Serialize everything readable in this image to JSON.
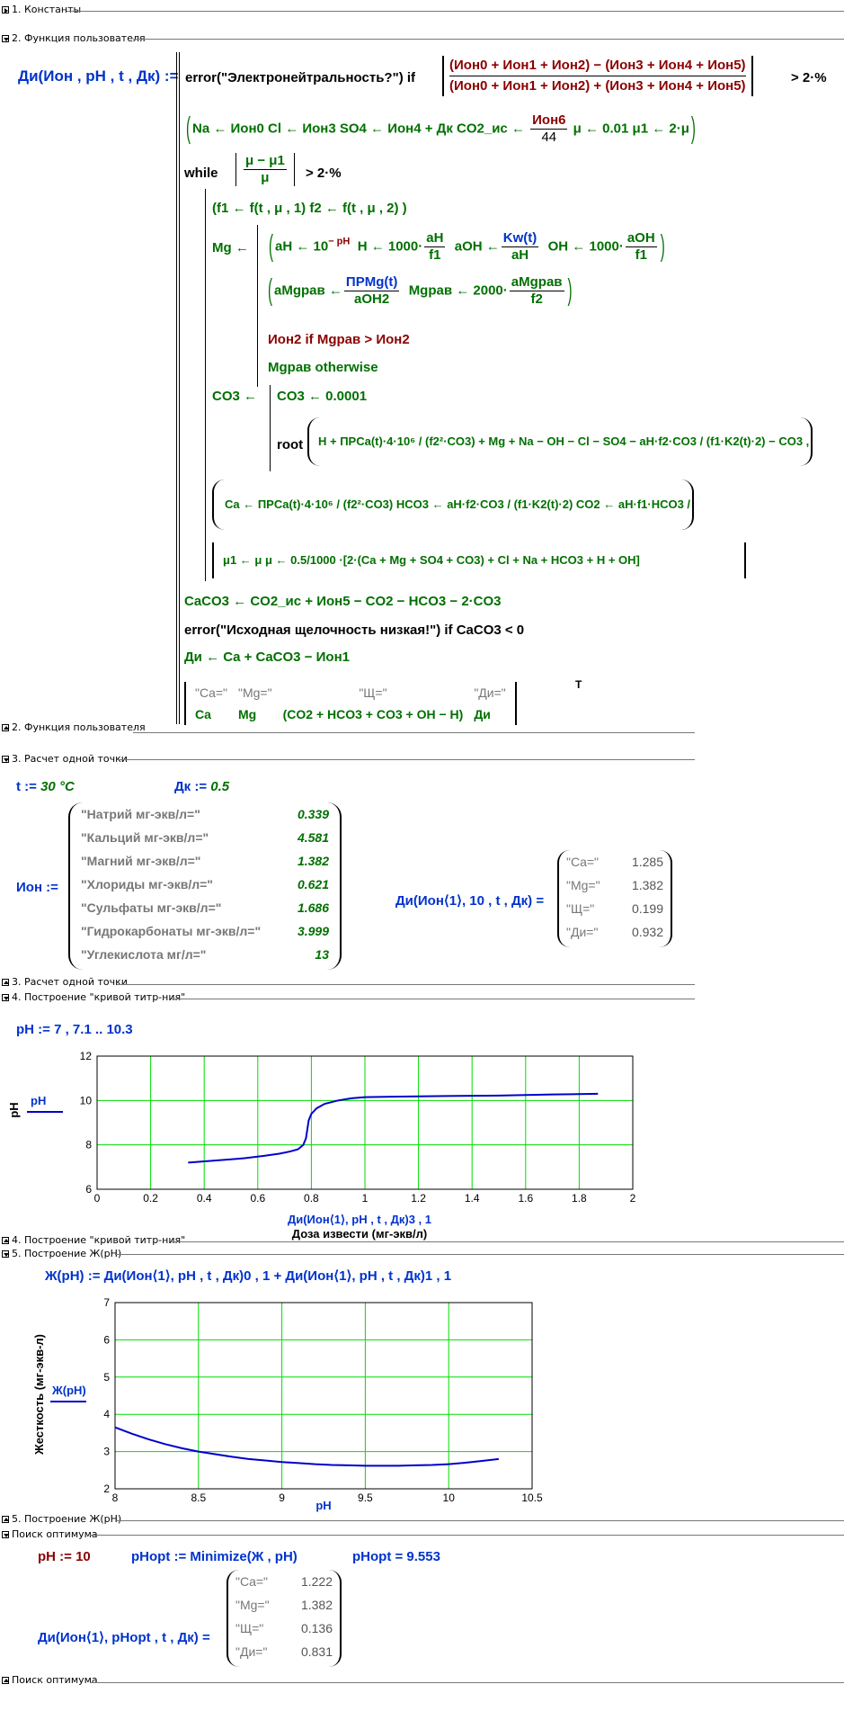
{
  "regions": {
    "r1": "1. Константы",
    "r2": "2. Функция пользователя",
    "r3": "3. Расчет одной точки",
    "r4": "4. Построение \"кривой титр-ния\"",
    "r5": "5. Построение Ж(pH)",
    "r6": "Поиск оптимума"
  },
  "func": {
    "header": "Ди(Ион , pH , t , Дк) :=",
    "error1": "error(\"Электронейтральность?\") if",
    "cond1_num": "(Ион0 + Ион1 + Ион2) − (Ион3 + Ион4 + Ион5)",
    "cond1_den": "(Ион0 + Ион1 + Ион2) + (Ион3 + Ион4 + Ион5)",
    "cond1_rhs": "> 2·%",
    "assign1": "Na ← Ион0   Cl ← Ион3   SO4 ← Ион4 + Дк   CO2_ис ←",
    "assign1_frac_n": "Ион6",
    "assign1_frac_d": "44",
    "assign1_tail": "μ ← 0.01   μ1 ← 2·μ",
    "while": "while",
    "while_num": "μ − μ1",
    "while_den": "μ",
    "while_rhs": "> 2·%",
    "f_line": "(f1 ← f(t , μ , 1)   f2 ← f(t , μ , 2) )",
    "mg": "Mg ←",
    "mg_l1a": "aH ← 10",
    "mg_l1a_sup": "− pH",
    "mg_l1b": "H ← 1000·",
    "mg_l1b_n": "aH",
    "mg_l1b_d": "f1",
    "mg_l1c": "aOH ←",
    "mg_l1c_n": "Kw(t)",
    "mg_l1c_d": "aH",
    "mg_l1d": "OH ← 1000·",
    "mg_l1d_n": "aOH",
    "mg_l1d_d": "f1",
    "mg_l2a": "aMgрав ←",
    "mg_l2a_n": "ПРMg(t)",
    "mg_l2a_d": "aOH2",
    "mg_l2b": "Mgрав ← 2000·",
    "mg_l2b_n": "aMgрав",
    "mg_l2b_d": "f2",
    "mg_l3": "Ион2   if   Mgрав > Ион2",
    "mg_l4": "Mgрав   otherwise",
    "co3": "CO3 ←",
    "co3_l1": "CO3 ← 0.0001",
    "co3_root": "root",
    "co3_root_expr": "H + ПРCa(t)·4·10⁶ / (f2²·CO3) + Mg + Na − OH − Cl − SO4 − aH·f2·CO3 / (f1·K2(t)·2) − CO3 , CO3",
    "ca_line": "Ca ← ПРCa(t)·4·10⁶ / (f2²·CO3)   HCO3 ← aH·f2·CO3 / (f1·K2(t)·2)   CO2 ← aH·f1·HCO3 / K1(t)",
    "mu_line": "μ1 ← μ   μ ← 0.5/1000 ·[2·(Ca + Mg + SO4 + CO3) + Cl + Na + HCO3 + H + OH]",
    "caco3_line": "CaCO3 ← CO2_ис + Ион5 − CO2 − HCO3 − 2·CO3",
    "error2": "error(\"Исходная щелочность низкая!\")   if   CaCO3 < 0",
    "di_line": "Ди ← Ca + CaCO3 − Ион1",
    "ret_h": [
      "\"Ca=\"",
      "\"Mg=\"",
      "\"Щ=\"",
      "\"Ди=\""
    ],
    "ret_v": [
      "Ca",
      "Mg",
      "(CO2 + HCO3 + CO3 + OH − H)",
      "Ди"
    ],
    "ret_T": "T"
  },
  "calc": {
    "t_def": "t := ",
    "t_val": "30 °C",
    "dk_def": "Дк := ",
    "dk_val": "0.5",
    "ion_def": "Ион :=",
    "ion_labels": [
      "\"Натрий мг-экв/л=\"",
      "\"Кальций мг-экв/л=\"",
      "\"Магний мг-экв/л=\"",
      "\"Хлориды мг-экв/л=\"",
      "\"Сульфаты мг-экв/л=\"",
      "\"Гидрокарбонаты мг-экв/л=\"",
      "\"Углекислота мг/л=\""
    ],
    "ion_values": [
      "0.339",
      "4.581",
      "1.382",
      "0.621",
      "1.686",
      "3.999",
      "13"
    ],
    "call": "Ди(Ион⟨1⟩, 10 , t , Дк) =",
    "res_labels": [
      "\"Ca=\"",
      "\"Mg=\"",
      "\"Щ=\"",
      "\"Ди=\""
    ],
    "res_values": [
      "1.285",
      "1.382",
      "0.199",
      "0.932"
    ]
  },
  "titr": {
    "ph_def": "pH := 7 , 7.1 .. 10.3",
    "ylabel": "pH",
    "legend": "pH",
    "xlabel_expr": "Ди(Ион⟨1⟩, pH , t , Дк)3 , 1",
    "xlabel": "Доза извести (мг-экв/л)"
  },
  "hard": {
    "def": "Ж(pH) := Ди(Ион⟨1⟩, pH , t , Дк)0 , 1 + Ди(Ион⟨1⟩, pH , t , Дк)1 , 1",
    "ylabel": "Жесткость (мг-экв-л)",
    "legend": "Ж(pH)",
    "xlabel": "pH"
  },
  "opt": {
    "ph_set": "pH := 10",
    "min_def": "pHopt := Minimize(Ж , pH)",
    "res": "pHopt = 9.553",
    "call": "Ди(Ион⟨1⟩, pHopt , t , Дк) =",
    "res_labels": [
      "\"Ca=\"",
      "\"Mg=\"",
      "\"Щ=\"",
      "\"Ди=\""
    ],
    "res_values": [
      "1.222",
      "1.382",
      "0.136",
      "0.831"
    ]
  },
  "chart_data": [
    {
      "type": "line",
      "title": "",
      "xlabel": "Доза извести (мг-экв/л)",
      "ylabel": "pH",
      "xlim": [
        0,
        2
      ],
      "ylim": [
        6,
        12
      ],
      "xticks": [
        0,
        0.2,
        0.4,
        0.6,
        0.8,
        1,
        1.2,
        1.4,
        1.6,
        1.8,
        2
      ],
      "yticks": [
        6,
        8,
        10,
        12
      ],
      "grid": true,
      "series": [
        {
          "name": "pH",
          "color": "#0000cc",
          "x": [
            0.34,
            0.45,
            0.55,
            0.62,
            0.68,
            0.72,
            0.75,
            0.77,
            0.78,
            0.785,
            0.79,
            0.8,
            0.82,
            0.85,
            0.9,
            0.95,
            1.0,
            1.1,
            1.3,
            1.5,
            1.7,
            1.87
          ],
          "y": [
            7.2,
            7.3,
            7.4,
            7.5,
            7.6,
            7.7,
            7.8,
            8.0,
            8.3,
            8.7,
            9.1,
            9.4,
            9.65,
            9.85,
            10.0,
            10.1,
            10.15,
            10.17,
            10.2,
            10.22,
            10.27,
            10.3
          ]
        }
      ]
    },
    {
      "type": "line",
      "title": "",
      "xlabel": "pH",
      "ylabel": "Жесткость (мг-экв-л)",
      "xlim": [
        8,
        10.5
      ],
      "ylim": [
        2,
        7
      ],
      "xticks": [
        8,
        8.5,
        9,
        9.5,
        10,
        10.5
      ],
      "yticks": [
        2,
        3,
        4,
        5,
        6,
        7
      ],
      "grid": true,
      "series": [
        {
          "name": "Ж(pH)",
          "color": "#0000cc",
          "x": [
            8.0,
            8.1,
            8.2,
            8.3,
            8.4,
            8.5,
            8.6,
            8.7,
            8.8,
            8.9,
            9.0,
            9.1,
            9.2,
            9.3,
            9.4,
            9.5,
            9.6,
            9.7,
            9.8,
            9.9,
            10.0,
            10.1,
            10.2,
            10.3
          ],
          "y": [
            3.65,
            3.48,
            3.33,
            3.2,
            3.09,
            3.0,
            2.93,
            2.86,
            2.8,
            2.76,
            2.72,
            2.69,
            2.66,
            2.64,
            2.63,
            2.62,
            2.62,
            2.62,
            2.63,
            2.64,
            2.66,
            2.7,
            2.75,
            2.8
          ]
        }
      ]
    }
  ]
}
